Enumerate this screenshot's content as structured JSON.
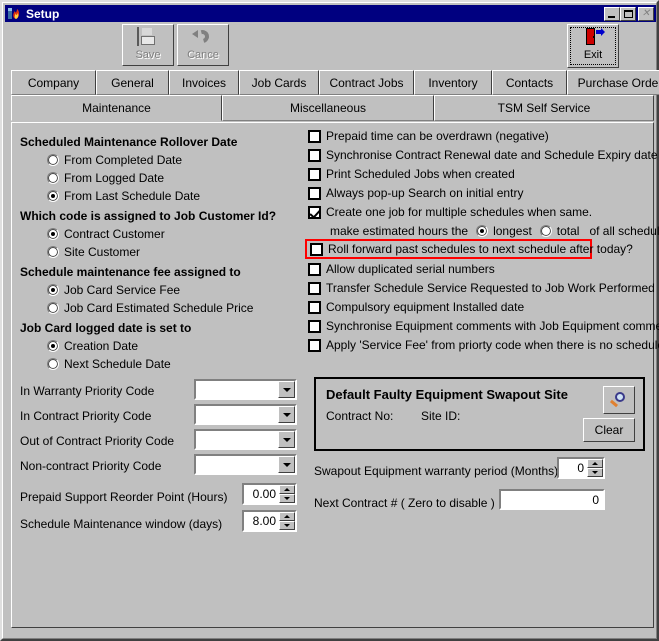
{
  "window": {
    "title": "Setup",
    "app_icon": "setup-flame-icon",
    "controls": {
      "minimize": "minimize-icon",
      "maximize": "maximize-icon",
      "close": "close-icon"
    }
  },
  "toolbar": {
    "buttons": [
      {
        "label": "Save",
        "icon": "floppy-disk-icon",
        "enabled": false
      },
      {
        "label": "Cance",
        "icon": "undo-arrow-icon",
        "enabled": false
      },
      {
        "label": "Exit",
        "icon": "exit-door-icon",
        "enabled": true
      }
    ]
  },
  "tabs_row1": [
    {
      "label": "Company",
      "active": false
    },
    {
      "label": "General",
      "active": false
    },
    {
      "label": "Invoices",
      "active": false
    },
    {
      "label": "Job Cards",
      "active": false
    },
    {
      "label": "Contract Jobs",
      "active": false
    },
    {
      "label": "Inventory",
      "active": false
    },
    {
      "label": "Contacts",
      "active": false
    },
    {
      "label": "Purchase Orders",
      "active": false
    }
  ],
  "tabs_row2": [
    {
      "label": "Maintenance",
      "active": true
    },
    {
      "label": "Miscellaneous",
      "active": false
    },
    {
      "label": "TSM Self Service",
      "active": false
    }
  ],
  "left": {
    "group1": {
      "heading": "Scheduled Maintenance Rollover Date",
      "options": [
        {
          "label": "From Completed Date",
          "selected": false
        },
        {
          "label": "From Logged Date",
          "selected": false
        },
        {
          "label": "From Last Schedule Date",
          "selected": true
        }
      ]
    },
    "group2": {
      "heading": "Which code is assigned to Job Customer Id?",
      "options": [
        {
          "label": "Contract Customer",
          "selected": true
        },
        {
          "label": "Site Customer",
          "selected": false
        }
      ]
    },
    "group3": {
      "heading": "Schedule maintenance fee assigned to",
      "options": [
        {
          "label": "Job Card Service Fee",
          "selected": true
        },
        {
          "label": "Job Card Estimated Schedule Price",
          "selected": false
        }
      ]
    },
    "group4": {
      "heading": "Job Card logged date is set to",
      "options": [
        {
          "label": "Creation Date",
          "selected": true
        },
        {
          "label": "Next Schedule Date",
          "selected": false
        }
      ]
    },
    "combos": [
      {
        "label": "In Warranty Priority Code",
        "value": ""
      },
      {
        "label": "In Contract Priority Code",
        "value": ""
      },
      {
        "label": "Out of Contract Priority Code",
        "value": ""
      },
      {
        "label": "Non-contract Priority Code",
        "value": ""
      }
    ],
    "spinners": [
      {
        "label": "Prepaid Support Reorder Point (Hours)",
        "value": "0.00"
      },
      {
        "label": "Schedule Maintenance window (days)",
        "value": "8.00"
      }
    ]
  },
  "right": {
    "checkboxes": [
      {
        "label": "Prepaid time can be overdrawn (negative)",
        "checked": false,
        "highlighted": false
      },
      {
        "label": "Synchronise Contract Renewal date and Schedule Expiry date",
        "checked": false,
        "highlighted": false
      },
      {
        "label": "Print Scheduled Jobs when created",
        "checked": false,
        "highlighted": false
      },
      {
        "label": "Always pop-up Search on initial entry",
        "checked": false,
        "highlighted": false
      },
      {
        "label": "Create one job for multiple schedules when same.",
        "checked": true,
        "highlighted": false
      }
    ],
    "sub_row": {
      "prefix": "make estimated hours the",
      "options": [
        {
          "label": "longest",
          "selected": true
        },
        {
          "label": "total",
          "selected": false
        }
      ],
      "suffix": "of all schedules"
    },
    "checkboxes2": [
      {
        "label": "Roll forward past schedules to next schedule after today?",
        "checked": false,
        "highlighted": true
      },
      {
        "label": "Allow duplicated serial numbers",
        "checked": false,
        "highlighted": false
      },
      {
        "label": "Transfer Schedule Service Requested to Job Work Performed",
        "checked": false,
        "highlighted": false
      },
      {
        "label": "Compulsory equipment Installed date",
        "checked": false,
        "highlighted": false
      },
      {
        "label": "Synchronise Equipment comments with Job Equipment comments",
        "checked": false,
        "highlighted": false
      },
      {
        "label": "Apply 'Service Fee' from priorty code when there is no schedule fee.",
        "checked": false,
        "highlighted": false
      }
    ],
    "swapout_group": {
      "title": "Default Faulty Equipment Swapout Site",
      "contract_no_label": "Contract No:",
      "contract_no_value": "",
      "site_id_label": "Site ID:",
      "site_id_value": "",
      "search_icon": "magnifier-icon",
      "clear_label": "Clear"
    },
    "warranty_spin": {
      "label": "Swapout Equipment warranty period (Months)",
      "value": "0"
    },
    "next_contract": {
      "label": "Next Contract # ( Zero to disable )",
      "value": "0"
    }
  },
  "colors": {
    "titlebar": "#000080",
    "face": "#c0c0c0",
    "highlight": "#ff0000",
    "field": "#ffffff"
  }
}
